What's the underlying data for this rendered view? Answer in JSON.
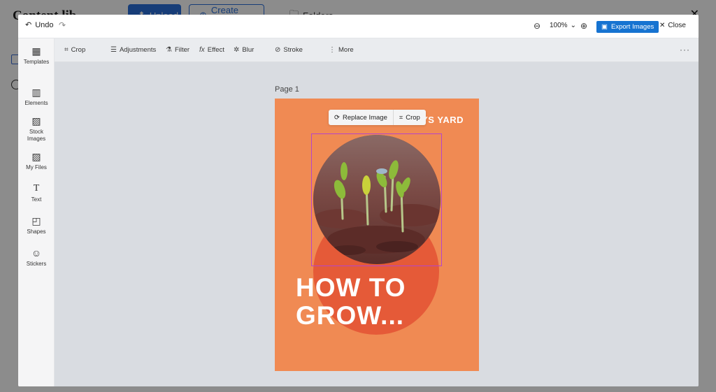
{
  "background_app": {
    "title": "Content lib",
    "upload_label": "Upload",
    "create_label": "Create image",
    "folders_label": "Folders"
  },
  "topbar": {
    "undo_label": "Undo",
    "zoom_value": "100%",
    "export_label": "Export Images",
    "close_label": "Close"
  },
  "sidebar": {
    "items": [
      {
        "label": "Templates",
        "icon": "templates-icon"
      },
      {
        "label": "Elements",
        "icon": "elements-icon"
      },
      {
        "label": "Stock Images",
        "icon": "stock-images-icon"
      },
      {
        "label": "My Files",
        "icon": "my-files-icon"
      },
      {
        "label": "Text",
        "icon": "text-icon"
      },
      {
        "label": "Shapes",
        "icon": "shapes-icon"
      },
      {
        "label": "Stickers",
        "icon": "stickers-icon"
      }
    ]
  },
  "toolbar": {
    "crop": "Crop",
    "adjustments": "Adjustments",
    "filter": "Filter",
    "effect": "Effect",
    "blur": "Blur",
    "stroke": "Stroke",
    "more": "More"
  },
  "canvas": {
    "page_label": "Page 1",
    "brand_text": "NYS YARD",
    "headline_line1": "HOW TO",
    "headline_line2": "GROW...",
    "float_replace": "Replace Image",
    "float_crop": "Crop"
  },
  "colors": {
    "accent": "#1673d1",
    "page_bg": "#f08a53",
    "circle": "#e55a38",
    "selection": "#b545c9"
  }
}
